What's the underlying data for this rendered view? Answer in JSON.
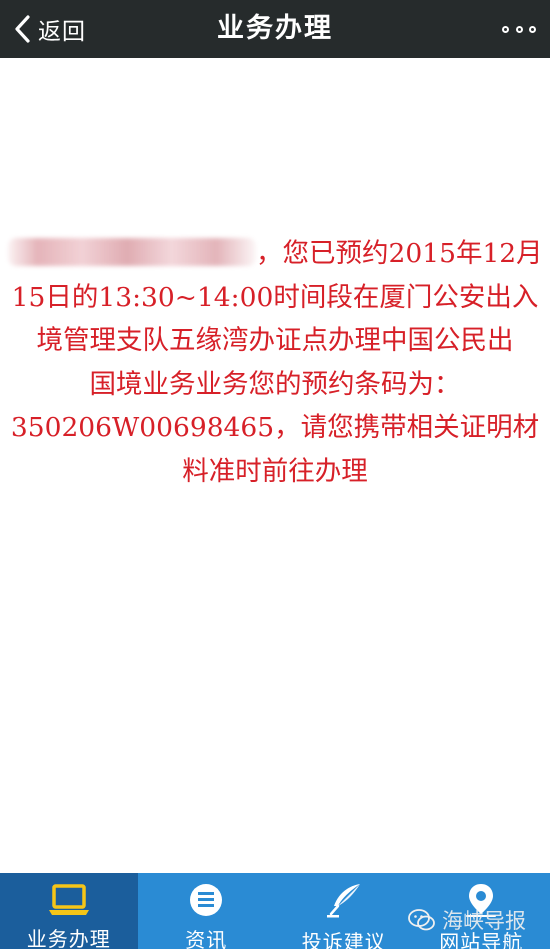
{
  "topbar": {
    "back_label": "返回",
    "title": "业务办理",
    "back_icon": "chevron-left-icon",
    "more_icon": "more-dots-icon",
    "bg_color": "#262b2c"
  },
  "message": {
    "color": "#d72028",
    "lines": [
      "，您已预约2015年12月",
      "15日的13:30~14:00时间段在厦门公安出入",
      "境管理支队五缘湾办证点办理中国公民出",
      "国境业务业务您的预约条码为：",
      "350206W00698465，请您携带相关证明材",
      "料准时前往办理"
    ]
  },
  "tabbar": {
    "bg_color": "#2a8bd4",
    "active_color": "#1b5e9c",
    "tabs": [
      {
        "label": "业务办理",
        "icon": "laptop-icon",
        "active": true
      },
      {
        "label": "资讯",
        "icon": "news-icon",
        "active": false
      },
      {
        "label": "投诉建议",
        "icon": "feather-pen-icon",
        "active": false
      },
      {
        "label": "网站导航",
        "icon": "location-pin-icon",
        "active": false
      }
    ]
  },
  "watermark": {
    "text": "海峡导报",
    "icon": "wechat-icon"
  }
}
